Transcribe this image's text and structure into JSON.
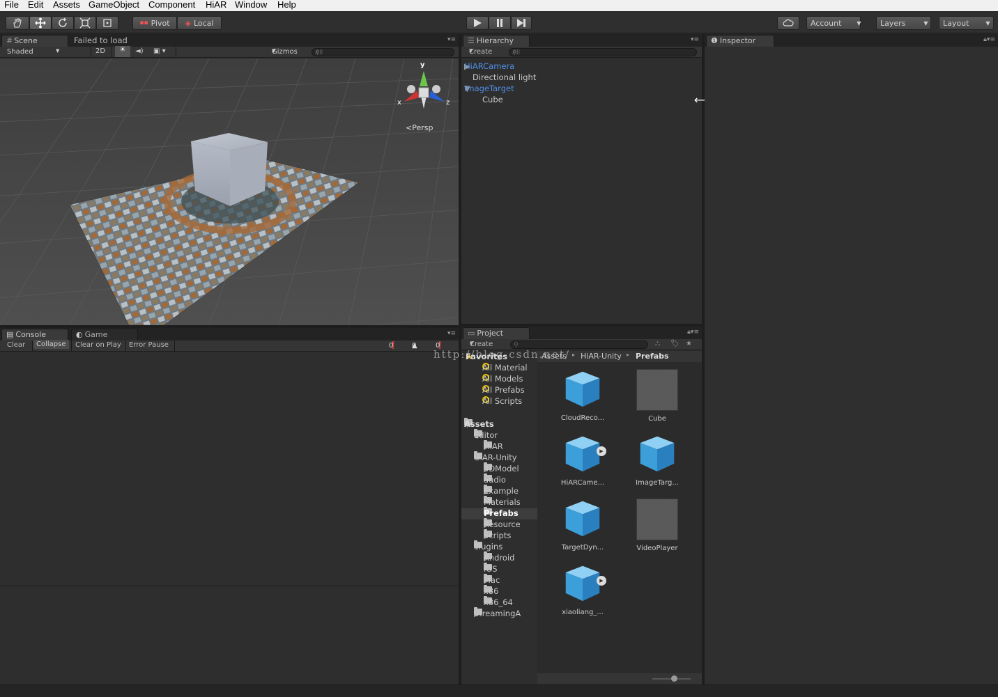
{
  "menu": [
    "File",
    "Edit",
    "Assets",
    "GameObject",
    "Component",
    "HiAR",
    "Window",
    "Help"
  ],
  "toolbar": {
    "pivot": "Pivot",
    "local": "Local",
    "account": "Account",
    "layers": "Layers",
    "layout": "Layout"
  },
  "scene": {
    "tab": "Scene",
    "failed": "Failed to load",
    "shaded": "Shaded",
    "twoD": "2D",
    "gizmos": "Gizmos",
    "search": "All",
    "persp": "Persp",
    "axes": {
      "y": "y",
      "x": "x",
      "z": "z"
    }
  },
  "hierarchy": {
    "tab": "Hierarchy",
    "create": "Create",
    "search": "All",
    "items": [
      {
        "label": "HiARCamera",
        "blue": true
      },
      {
        "label": "Directional light",
        "blue": false
      },
      {
        "label": "ImageTarget",
        "blue": true
      },
      {
        "label": "Cube",
        "blue": false
      }
    ]
  },
  "inspector": {
    "tab": "Inspector"
  },
  "console": {
    "tab": "Console",
    "game_tab": "Game",
    "clear": "Clear",
    "collapse": "Collapse",
    "clear_on_play": "Clear on Play",
    "error_pause": "Error Pause",
    "counts": [
      "0",
      "0",
      "0"
    ]
  },
  "project": {
    "tab": "Project",
    "create": "Create",
    "favorites": "Favorites",
    "fav_items": [
      "All Material",
      "All Models",
      "All Prefabs",
      "All Scripts"
    ],
    "breadcrumb": [
      "Assets",
      "HiAR-Unity",
      "Prefabs"
    ],
    "tree": [
      {
        "label": "Assets",
        "indent": 0,
        "open": true,
        "bold": true
      },
      {
        "label": "Editor",
        "indent": 1,
        "open": true
      },
      {
        "label": "HiAR",
        "indent": 2,
        "open": false
      },
      {
        "label": "HiAR-Unity",
        "indent": 1,
        "open": true
      },
      {
        "label": "3DModel",
        "indent": 2,
        "open": false
      },
      {
        "label": "audio",
        "indent": 2,
        "open": null
      },
      {
        "label": "Example",
        "indent": 2,
        "open": false
      },
      {
        "label": "Materials",
        "indent": 2,
        "open": null
      },
      {
        "label": "Prefabs",
        "indent": 2,
        "open": null,
        "selected": true
      },
      {
        "label": "Resource",
        "indent": 2,
        "open": false
      },
      {
        "label": "Scripts",
        "indent": 2,
        "open": false
      },
      {
        "label": "Plugins",
        "indent": 1,
        "open": true
      },
      {
        "label": "Android",
        "indent": 2,
        "open": false
      },
      {
        "label": "iOS",
        "indent": 2,
        "open": null
      },
      {
        "label": "Mac",
        "indent": 2,
        "open": false
      },
      {
        "label": "x86",
        "indent": 2,
        "open": null
      },
      {
        "label": "x86_64",
        "indent": 2,
        "open": null
      },
      {
        "label": "StreamingA",
        "indent": 1,
        "open": false
      }
    ],
    "assets": [
      {
        "label": "CloudReco...",
        "type": "cube"
      },
      {
        "label": "Cube",
        "type": "gray"
      },
      {
        "label": "HiARCame...",
        "type": "cube",
        "play": true
      },
      {
        "label": "ImageTarg...",
        "type": "cube"
      },
      {
        "label": "TargetDyn...",
        "type": "cube"
      },
      {
        "label": "VideoPlayer",
        "type": "gray"
      },
      {
        "label": "xiaoliang_...",
        "type": "cube",
        "play": true
      }
    ]
  },
  "watermark": "http://blog.csdn.net/"
}
